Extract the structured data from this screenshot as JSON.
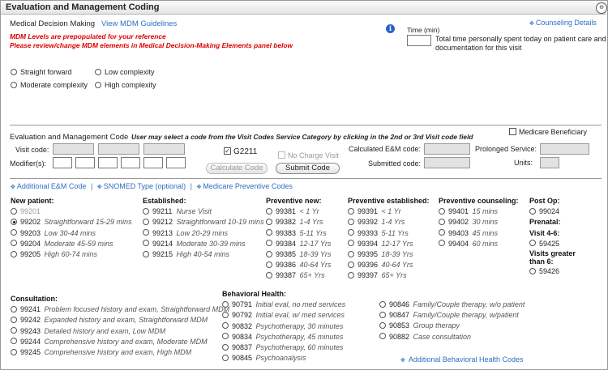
{
  "header": {
    "title": "Evaluation and Management Coding",
    "collapse_glyph": "⊖"
  },
  "mdm": {
    "label": "Medical Decision Making",
    "guidelines_link": "View MDM Guidelines",
    "notice1": "MDM Levels are prepopulated for your reference",
    "notice2": "Please review/change MDM elements in Medical Decision-Making Elements panel below",
    "options": [
      {
        "label": "Straight forward",
        "selected": false
      },
      {
        "label": "Low complexity",
        "selected": false
      },
      {
        "label": "Moderate complexity",
        "selected": false
      },
      {
        "label": "High complexity",
        "selected": false
      }
    ]
  },
  "counseling_link": "Counseling Details",
  "time": {
    "label": "Time",
    "unit": "(min)",
    "desc1": "Total time personally spent today on patient care and",
    "desc2": "documentation for this visit",
    "value": ""
  },
  "em": {
    "label": "Evaluation and Management Code",
    "hint": "User may select a code from the Visit Codes Service Category by clicking in the 2nd or 3rd Visit code field",
    "medicare_label": "Medicare Beneficiary",
    "visit_label": "Visit code:",
    "modifier_label": "Modifier(s):",
    "g2211_label": "G2211",
    "g2211_checked": true,
    "no_charge_label": "No Charge Visit",
    "calc_button": "Calculate Code",
    "submit_button": "Submit Code",
    "calculated_label": "Calculated E&M code:",
    "submitted_label": "Submitted code:",
    "prolonged_label": "Prolonged Service:",
    "units_label": "Units:"
  },
  "links": {
    "additional": "Additional E&M Code",
    "snomed": "SNOMED Type (optional)",
    "medicare": "Medicare Preventive Codes",
    "divider": "|"
  },
  "new_patient": {
    "title": "New patient:",
    "items": [
      {
        "code": "99201",
        "desc": "",
        "muted": true,
        "selected": false
      },
      {
        "code": "99202",
        "desc": "Straightforward 15-29 mins",
        "muted": false,
        "selected": true
      },
      {
        "code": "99203",
        "desc": "Low 30-44 mins",
        "muted": false,
        "selected": false
      },
      {
        "code": "99204",
        "desc": "Moderate 45-59 mins",
        "muted": false,
        "selected": false
      },
      {
        "code": "99205",
        "desc": "High 60-74 mins",
        "muted": false,
        "selected": false
      }
    ]
  },
  "established": {
    "title": "Established:",
    "items": [
      {
        "code": "99211",
        "desc": "Nurse Visit"
      },
      {
        "code": "99212",
        "desc": "Straightforward 10-19 mins"
      },
      {
        "code": "99213",
        "desc": "Low 20-29 mins"
      },
      {
        "code": "99214",
        "desc": "Moderate 30-39 mins"
      },
      {
        "code": "99215",
        "desc": "High 40-54 mins"
      }
    ]
  },
  "preventive_new": {
    "title": "Preventive new:",
    "items": [
      {
        "code": "99381",
        "desc": "< 1 Yr"
      },
      {
        "code": "99382",
        "desc": "1-4 Yrs"
      },
      {
        "code": "99383",
        "desc": "5-11 Yrs"
      },
      {
        "code": "99384",
        "desc": "12-17 Yrs"
      },
      {
        "code": "99385",
        "desc": "18-39 Yrs"
      },
      {
        "code": "99386",
        "desc": "40-64 Yrs"
      },
      {
        "code": "99387",
        "desc": "65+ Yrs"
      }
    ]
  },
  "preventive_est": {
    "title": "Preventive established:",
    "items": [
      {
        "code": "99391",
        "desc": "< 1 Yr"
      },
      {
        "code": "99392",
        "desc": "1-4 Yrs"
      },
      {
        "code": "99393",
        "desc": "5-11 Yrs"
      },
      {
        "code": "99394",
        "desc": "12-17 Yrs"
      },
      {
        "code": "99395",
        "desc": "18-39 Yrs"
      },
      {
        "code": "99396",
        "desc": "40-64 Yrs"
      },
      {
        "code": "99397",
        "desc": "65+ Yrs"
      }
    ]
  },
  "preventive_counseling": {
    "title": "Preventive counseling:",
    "items": [
      {
        "code": "99401",
        "desc": "15 mins"
      },
      {
        "code": "99402",
        "desc": "30 mins"
      },
      {
        "code": "99403",
        "desc": "45 mins"
      },
      {
        "code": "99404",
        "desc": "60 mins"
      }
    ]
  },
  "post_op": {
    "title": "Post Op:",
    "code": "99024",
    "prenatal": "Prenatal:",
    "visit46": "Visit 4-6:",
    "code2": "59425",
    "visits_greater1": "Visits greater",
    "visits_greater2": "than 6:",
    "code3": "59426"
  },
  "consultation": {
    "title": "Consultation:",
    "items": [
      {
        "code": "99241",
        "desc": "Problem focused history and exam, Straightforward MDM"
      },
      {
        "code": "99242",
        "desc": "Expanded history and exam, Straightforward MDM"
      },
      {
        "code": "99243",
        "desc": "Detailed history and exam, Low MDM"
      },
      {
        "code": "99244",
        "desc": "Comprehensive history and exam, Moderate MDM"
      },
      {
        "code": "99245",
        "desc": "Comprehensive history and exam, High MDM"
      }
    ]
  },
  "behavioral": {
    "title": "Behavioral Health:",
    "items": [
      {
        "code": "90791",
        "desc": "Initial eval, no med services"
      },
      {
        "code": "90792",
        "desc": "Initial eval, w/ med services"
      },
      {
        "code": "90832",
        "desc": "Psychotherapy, 30 minutes"
      },
      {
        "code": "90834",
        "desc": "Psychotherapy, 45 minutes"
      },
      {
        "code": "90837",
        "desc": "Psychotherapy, 60 minutes"
      },
      {
        "code": "90845",
        "desc": "Psychoanalysis"
      }
    ],
    "items2": [
      {
        "code": "90846",
        "desc": "Family/Couple therapy, w/o patient"
      },
      {
        "code": "90847",
        "desc": "Family/Couple therapy, w/patient"
      },
      {
        "code": "90853",
        "desc": "Group therapy"
      },
      {
        "code": "90882",
        "desc": "Case consultation"
      }
    ],
    "additional_link": "Additional Behavioral Health Codes"
  }
}
